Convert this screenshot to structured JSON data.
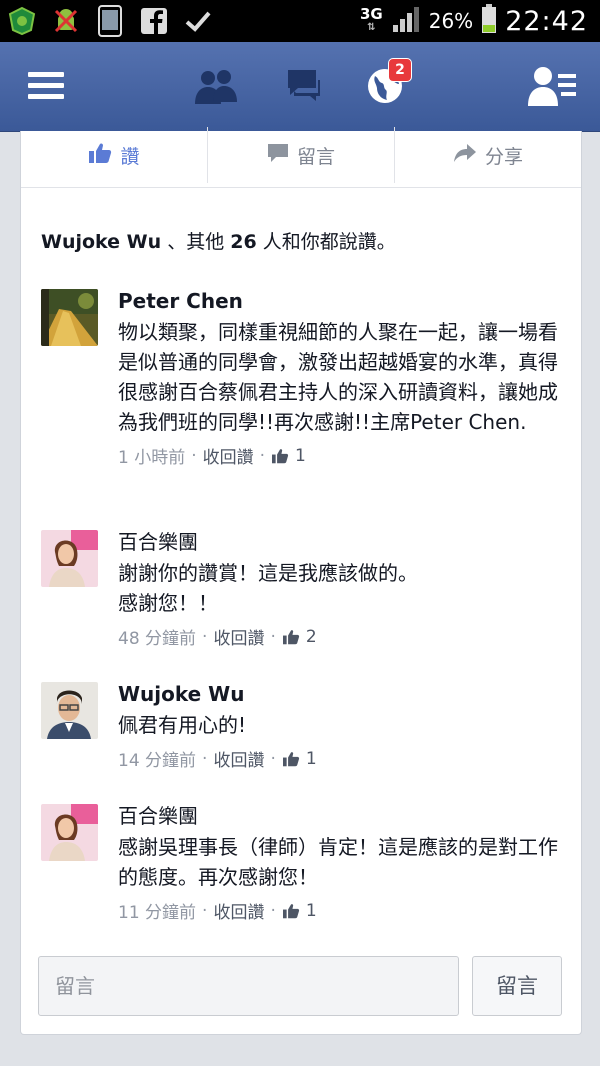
{
  "status_bar": {
    "network_type": "3G",
    "network_arrows": "⇅",
    "battery_percent": "26%",
    "time": "22:42",
    "icons": [
      "shield-icon",
      "android-disabled-icon",
      "phone-icon",
      "facebook-icon",
      "check-icon",
      "signal-icon",
      "battery-icon"
    ]
  },
  "header": {
    "icons": [
      "menu-icon",
      "friends-icon",
      "messages-icon",
      "notifications-globe-icon",
      "friend-requests-icon"
    ],
    "notification_count": "2",
    "accent": "#3b5998"
  },
  "post_actions": {
    "like_label": "讚",
    "comment_label": "留言",
    "share_label": "分享"
  },
  "likes": {
    "name": "Wujoke Wu",
    "mid": " 、其他 ",
    "count": "26",
    "tail": " 人和你都說讚。"
  },
  "comments": [
    {
      "author": "Peter Chen",
      "text": "物以類聚，同樣重視細節的人聚在一起，讓一場看是似普通的同學會，激發出超越婚宴的水準，真得很感謝百合蔡佩君主持人的深入研讀資料，讓她成為我們班的同學!!再次感謝!!主席Peter Chen.",
      "time": "1 小時前",
      "unlike": "收回讚",
      "like_count": "1"
    },
    {
      "author": "百合樂團",
      "text": "謝謝你的讚賞！這是我應該做的。\n感謝您！！",
      "time": "48 分鐘前",
      "unlike": "收回讚",
      "like_count": "2"
    },
    {
      "author": "Wujoke Wu",
      "text": "佩君有用心的!",
      "time": "14 分鐘前",
      "unlike": "收回讚",
      "like_count": "1"
    },
    {
      "author": "百合樂團",
      "text": "感謝吳理事長（律師）肯定！這是應該的是對工作的態度。再次感謝您！",
      "time": "11 分鐘前",
      "unlike": "收回讚",
      "like_count": "1"
    }
  ],
  "composer": {
    "placeholder": "留言",
    "button_label": "留言"
  },
  "meta": {
    "separator": "·"
  }
}
